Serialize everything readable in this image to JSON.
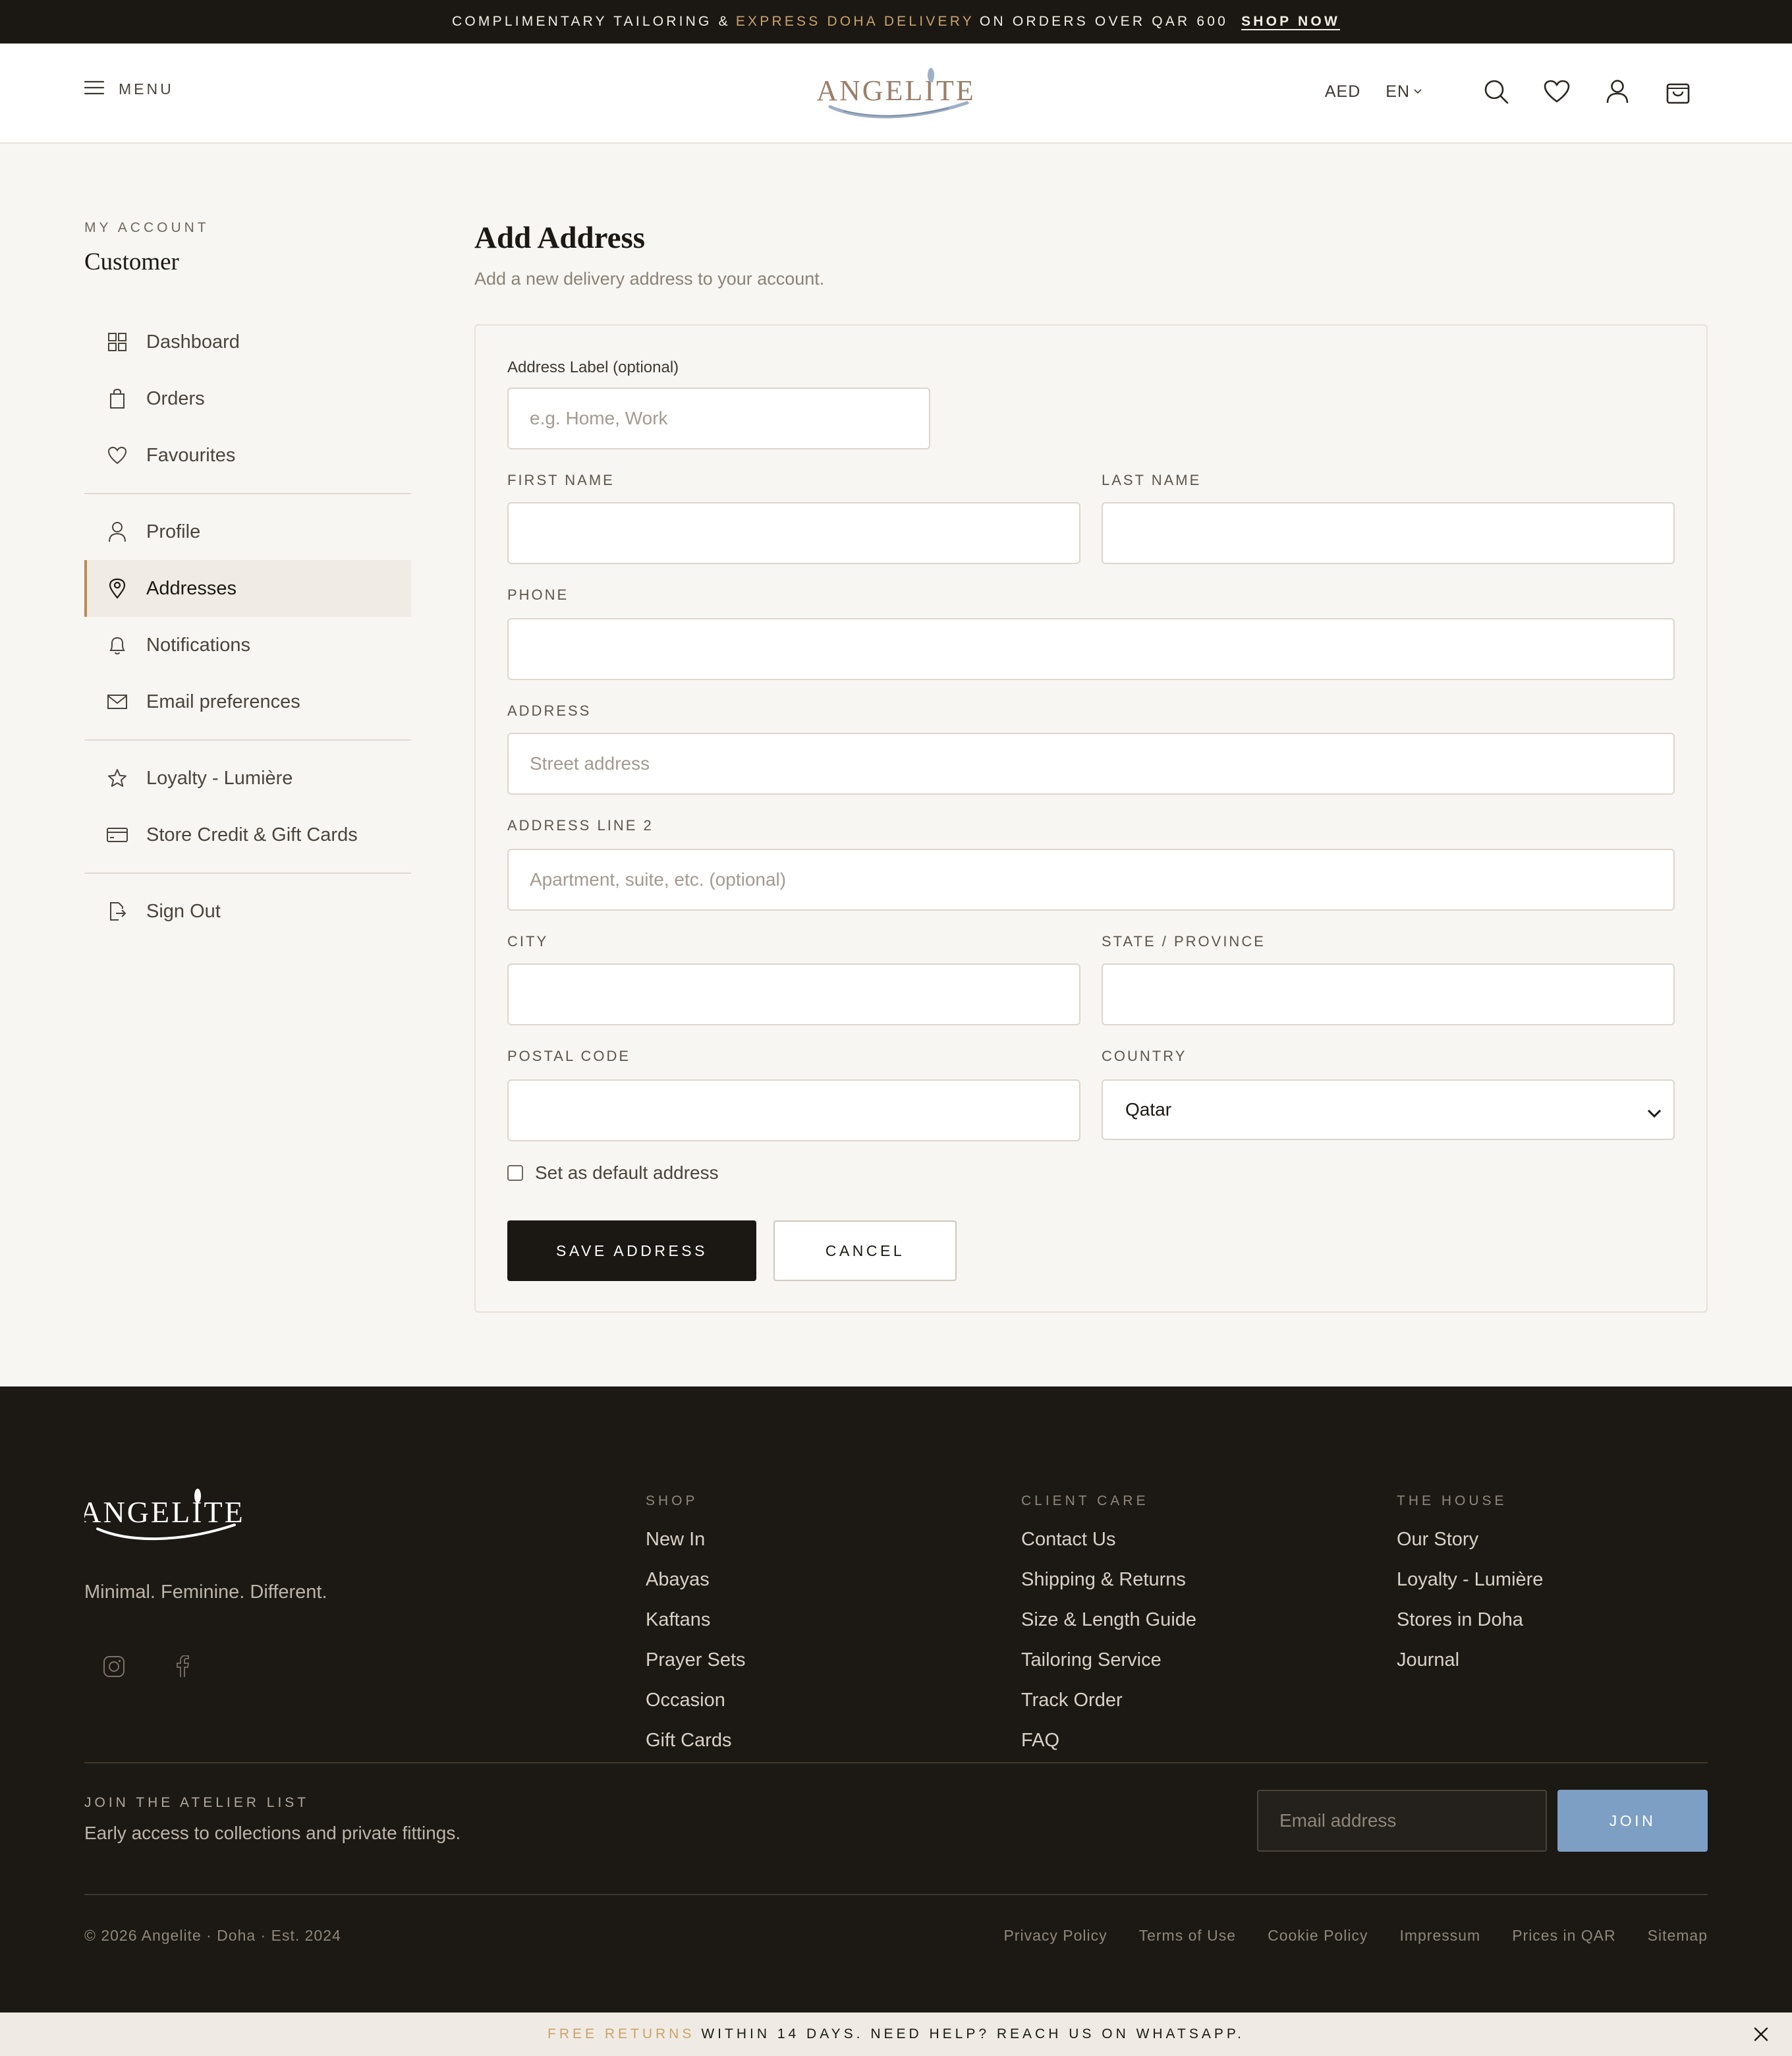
{
  "announcement": {
    "text_before": "Complimentary tailoring &",
    "text_accent": "Express Doha delivery",
    "text_after": "on orders over QAR 600",
    "cta": "Shop now"
  },
  "header": {
    "menu_label": "MENU",
    "logo_text": "ANGELITE",
    "currency": "AED",
    "language": "EN",
    "icons": [
      "search-icon",
      "heart-icon",
      "user-icon",
      "bag-icon"
    ]
  },
  "sidebar": {
    "eyebrow": "MY ACCOUNT",
    "name": "Customer",
    "groups": [
      [
        {
          "label": "Dashboard",
          "icon": "grid-icon"
        },
        {
          "label": "Orders",
          "icon": "bag-icon"
        },
        {
          "label": "Favourites",
          "icon": "heart-icon"
        }
      ],
      [
        {
          "label": "Profile",
          "icon": "user-icon"
        },
        {
          "label": "Addresses",
          "icon": "map-pin-icon",
          "active": true
        },
        {
          "label": "Notifications",
          "icon": "bell-icon"
        },
        {
          "label": "Email preferences",
          "icon": "mail-icon"
        }
      ],
      [
        {
          "label": "Loyalty - Lumière",
          "icon": "star-icon"
        },
        {
          "label": "Store Credit & Gift Cards",
          "icon": "card-icon"
        }
      ],
      [
        {
          "label": "Sign Out",
          "icon": "sign-out-icon"
        }
      ]
    ]
  },
  "main": {
    "title": "Add Address",
    "subtitle": "Add a new delivery address to your account.",
    "form": {
      "address_label": {
        "label": "Address Label (optional)",
        "placeholder": "e.g. Home, Work",
        "value": ""
      },
      "first_name": {
        "label": "FIRST NAME",
        "value": ""
      },
      "last_name": {
        "label": "LAST NAME",
        "value": ""
      },
      "phone": {
        "label": "PHONE",
        "value": ""
      },
      "address": {
        "label": "ADDRESS",
        "placeholder": "Street address",
        "value": ""
      },
      "address2": {
        "label": "ADDRESS LINE 2",
        "placeholder": "Apartment, suite, etc. (optional)",
        "value": ""
      },
      "city": {
        "label": "CITY",
        "value": ""
      },
      "state": {
        "label": "STATE / PROVINCE",
        "value": ""
      },
      "postal": {
        "label": "POSTAL CODE",
        "value": ""
      },
      "country": {
        "label": "COUNTRY",
        "value": "Qatar"
      },
      "default_checkbox": {
        "label": "Set as default address",
        "checked": false
      },
      "save_label": "SAVE ADDRESS",
      "cancel_label": "CANCEL"
    }
  },
  "footer": {
    "logo_text": "ANGELITE",
    "tagline": "Minimal. Feminine. Different.",
    "social": [
      "instagram-icon",
      "facebook-icon"
    ],
    "columns": [
      {
        "heading": "SHOP",
        "links": [
          "New In",
          "Abayas",
          "Kaftans",
          "Prayer Sets",
          "Occasion",
          "Gift Cards"
        ]
      },
      {
        "heading": "CLIENT CARE",
        "links": [
          "Contact Us",
          "Shipping & Returns",
          "Size & Length Guide",
          "Tailoring Service",
          "Track Order",
          "FAQ"
        ]
      },
      {
        "heading": "THE HOUSE",
        "links": [
          "Our Story",
          "Loyalty - Lumière",
          "Stores in Doha",
          "Journal"
        ]
      }
    ],
    "newsletter": {
      "heading": "JOIN THE ATELIER LIST",
      "subtext": "Early access to collections and private fittings.",
      "placeholder": "Email address",
      "button": "JOIN"
    },
    "copyright": "© 2026 Angelite · Doha · Est. 2024",
    "legal": [
      "Privacy Policy",
      "Terms of Use",
      "Cookie Policy",
      "Impressum",
      "Prices in QAR",
      "Sitemap"
    ]
  },
  "bottom_bar": {
    "accent": "Free returns",
    "text": "within 14 days. Need help? Reach us on WhatsApp."
  },
  "colors": {
    "dark": "#1b1814",
    "accent_gold": "#c9a36a",
    "join_button": "#7d9fc4",
    "background": "#f8f6f2"
  }
}
